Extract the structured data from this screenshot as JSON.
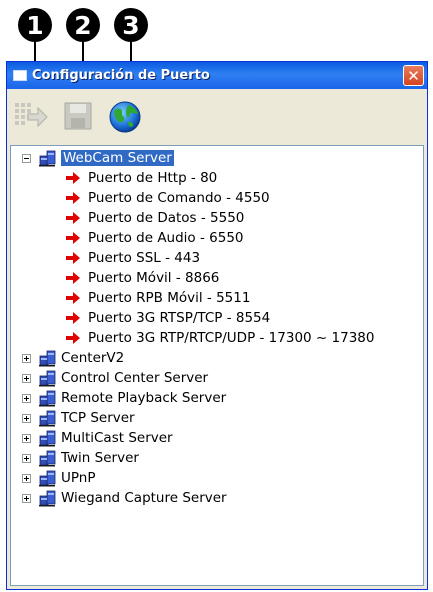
{
  "callouts": [
    "1",
    "2",
    "3"
  ],
  "window": {
    "title": "Configuración de Puerto",
    "close_glyph": "✕"
  },
  "toolbar": {
    "buttons": [
      {
        "name": "connect-icon",
        "state": "disabled"
      },
      {
        "name": "save-icon",
        "state": "disabled"
      },
      {
        "name": "globe-icon",
        "state": "enabled"
      }
    ]
  },
  "tree": {
    "selected": {
      "label": "WebCam Server",
      "expanded": true,
      "ports": [
        "Puerto de Http - 80",
        "Puerto de Comando - 4550",
        "Puerto de Datos - 5550",
        "Puerto de Audio - 6550",
        "Puerto SSL - 443",
        "Puerto Móvil - 8866",
        "Puerto RPB Móvil - 5511",
        "Puerto 3G RTSP/TCP - 8554",
        "Puerto 3G RTP/RTCP/UDP - 17300 ~ 17380"
      ]
    },
    "servers": [
      "CenterV2",
      "Control Center Server",
      "Remote Playback Server",
      "TCP Server",
      "MultiCast Server",
      "Twin Server",
      "UPnP",
      "Wiegand Capture Server"
    ]
  },
  "colors": {
    "titlebar": "#0a5be0",
    "selection": "#316ac5",
    "port_arrow": "#e00000"
  }
}
